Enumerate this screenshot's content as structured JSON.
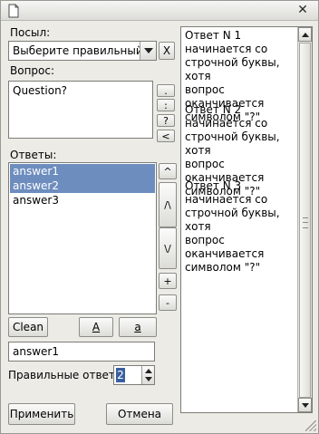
{
  "window": {
    "accent_color": "#6d8dbe",
    "title_icon": "document-icon",
    "close_glyph": "✕"
  },
  "form": {
    "posyl": {
      "label": "Посыл:",
      "combo_value": "Выберите правильный от",
      "clear_button_label": "X"
    },
    "vopros": {
      "label": "Вопрос:",
      "text": "Question?",
      "side_buttons": [
        ".",
        ":",
        "?",
        "<"
      ]
    },
    "otvety": {
      "label": "Ответы:",
      "items": [
        {
          "text": "answer1",
          "selected": true
        },
        {
          "text": "answer2",
          "selected": true
        },
        {
          "text": "answer3",
          "selected": false
        }
      ],
      "side_buttons": [
        "^",
        "/\\",
        "\\/",
        "+",
        "-"
      ]
    },
    "buttons": {
      "clean": "Clean",
      "upper": "A",
      "lower": "a"
    },
    "answer_input_value": "answer1",
    "correct_answers": {
      "label": "Правильные ответы",
      "value": "2"
    },
    "footer": {
      "apply": "Применить",
      "cancel": "Отмена"
    }
  },
  "preview": {
    "answers": [
      "Ответ N 1\nначинается со\nстрочной буквы, хотя\nвопрос оканчивается\nсимволом  \"?\"",
      "Ответ N 2\nначинается со\nстрочной буквы, хотя\nвопрос оканчивается\nсимволом  \"?\"",
      "Ответ N 3\nначинается со\nстрочной буквы, хотя\nвопрос оканчивается\nсимволом  \"?\""
    ]
  }
}
